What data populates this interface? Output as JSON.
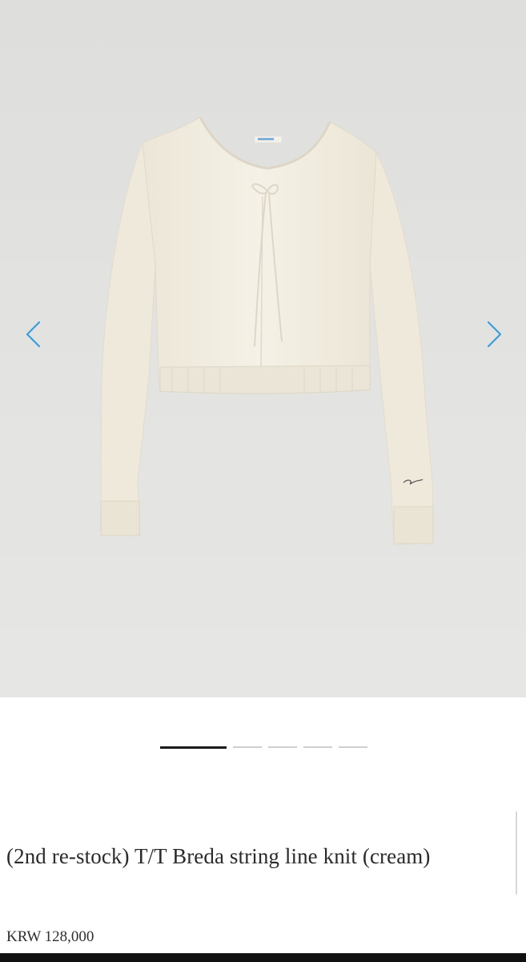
{
  "gallery": {
    "prev_icon": "chevron-left-icon",
    "next_icon": "chevron-right-icon",
    "accent_color": "#3a9fd8",
    "slide_count": 5,
    "active_slide": 1
  },
  "product": {
    "title": "(2nd re-stock) T/T Breda string line knit (cream)",
    "price": "KRW 128,000"
  }
}
